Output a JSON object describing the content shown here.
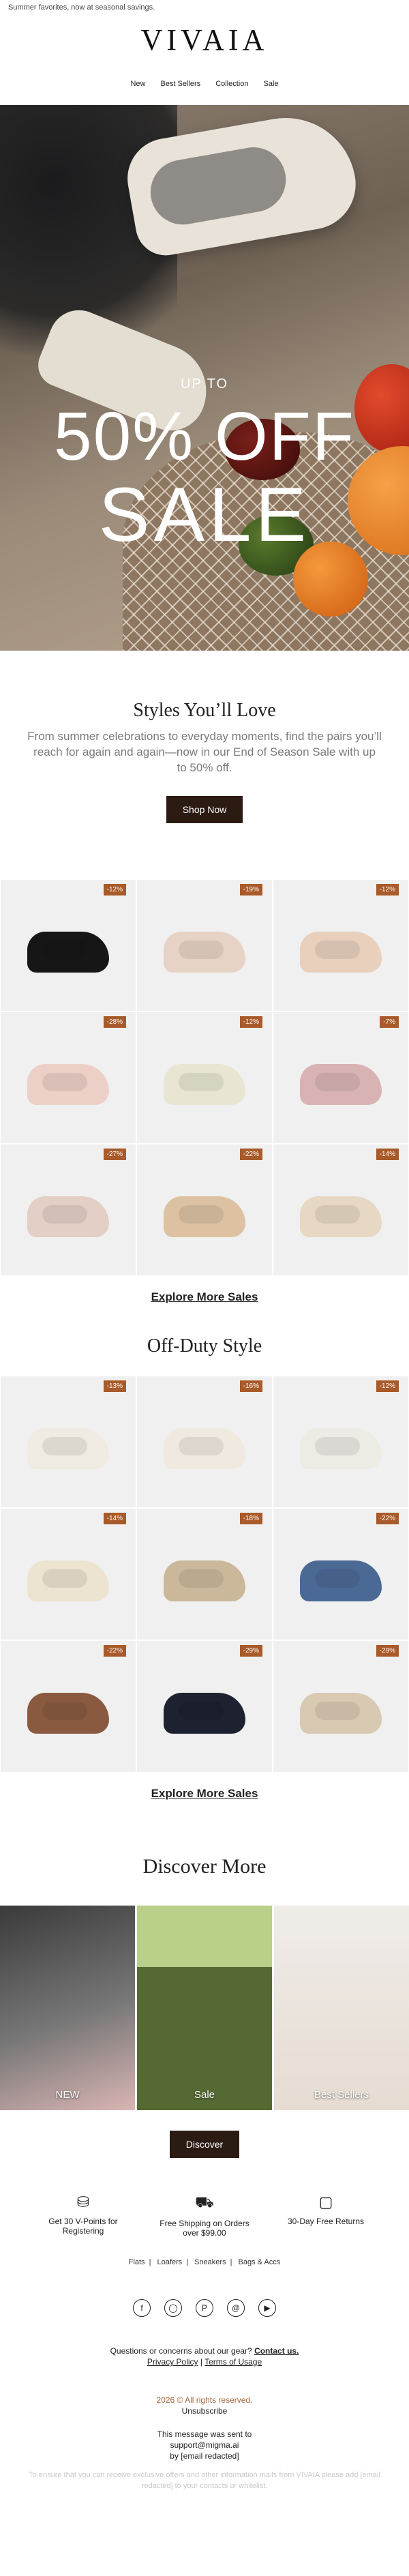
{
  "preheader": "Summer favorites, now at seasonal savings.",
  "brand": {
    "logo": "VIVAIA"
  },
  "nav": {
    "items": [
      "New",
      "Best Sellers",
      "Collection",
      "Sale"
    ]
  },
  "hero": {
    "line1": "UP TO",
    "line2": "50% OFF",
    "line3": "SALE"
  },
  "styles": {
    "title": "Styles You’ll Love",
    "body": "From summer celebrations to everyday moments, find the pairs you’ll reach for again and again—now in our End of Season Sale with up to 50% off.",
    "button": "Shop Now",
    "products": [
      {
        "badge": "-12%",
        "color": "#161616"
      },
      {
        "badge": "-19%",
        "color": "#e7d3c5"
      },
      {
        "badge": "-12%",
        "color": "#e8d0bd"
      },
      {
        "badge": "-28%",
        "color": "#ecd0c8"
      },
      {
        "badge": "-12%",
        "color": "#e8e5d3"
      },
      {
        "badge": "-7%",
        "color": "#d9b3b3"
      },
      {
        "badge": "-27%",
        "color": "#e3cfc6"
      },
      {
        "badge": "-22%",
        "color": "#dcc2a3"
      },
      {
        "badge": "-14%",
        "color": "#e7d8c4"
      }
    ],
    "more": "Explore More Sales"
  },
  "offduty": {
    "title": "Off-Duty Style",
    "products": [
      {
        "badge": "-13%",
        "color": "#efebe2"
      },
      {
        "badge": "-16%",
        "color": "#efe9df"
      },
      {
        "badge": "-12%",
        "color": "#ecebe4"
      },
      {
        "badge": "-14%",
        "color": "#ece3d0"
      },
      {
        "badge": "-18%",
        "color": "#cbb89a"
      },
      {
        "badge": "-22%",
        "color": "#4b6995"
      },
      {
        "badge": "-22%",
        "color": "#8a5a40"
      },
      {
        "badge": "-29%",
        "color": "#1d2130"
      },
      {
        "badge": "-29%",
        "color": "#d8c9b2"
      }
    ],
    "more": "Explore More Sales"
  },
  "discover": {
    "title": "Discover More",
    "tiles": [
      "NEW",
      "Sale",
      "Best Sellers"
    ],
    "button": "Discover"
  },
  "perks": [
    {
      "icon": "coins-icon",
      "text": "Get 30 V-Points for Registering"
    },
    {
      "icon": "truck-icon",
      "text": "Free Shipping on Orders over $99.00"
    },
    {
      "icon": "return-box-icon",
      "text": "30-Day Free Returns"
    }
  ],
  "categories": [
    "Flats",
    "Loafers",
    "Sneakers",
    "Bags & Accs"
  ],
  "social": [
    "facebook-icon",
    "instagram-icon",
    "pinterest-icon",
    "threads-icon",
    "youtube-icon"
  ],
  "footer": {
    "question": "Questions or concerns about our gear?",
    "contact": "Contact us.",
    "privacy": "Privacy Policy",
    "terms": "Terms of Usage",
    "copyright": "2026 © All rights reserved.",
    "unsubscribe": "Unsubscribe",
    "sent_line": "This message was sent to",
    "sent_email": "support@migma.ai",
    "sent_by": "by [email redacted]",
    "note": "To ensure that you can receive exclusive offers and other information mails from VIVAIA please add [email redacted] to your contacts or whitelist."
  }
}
